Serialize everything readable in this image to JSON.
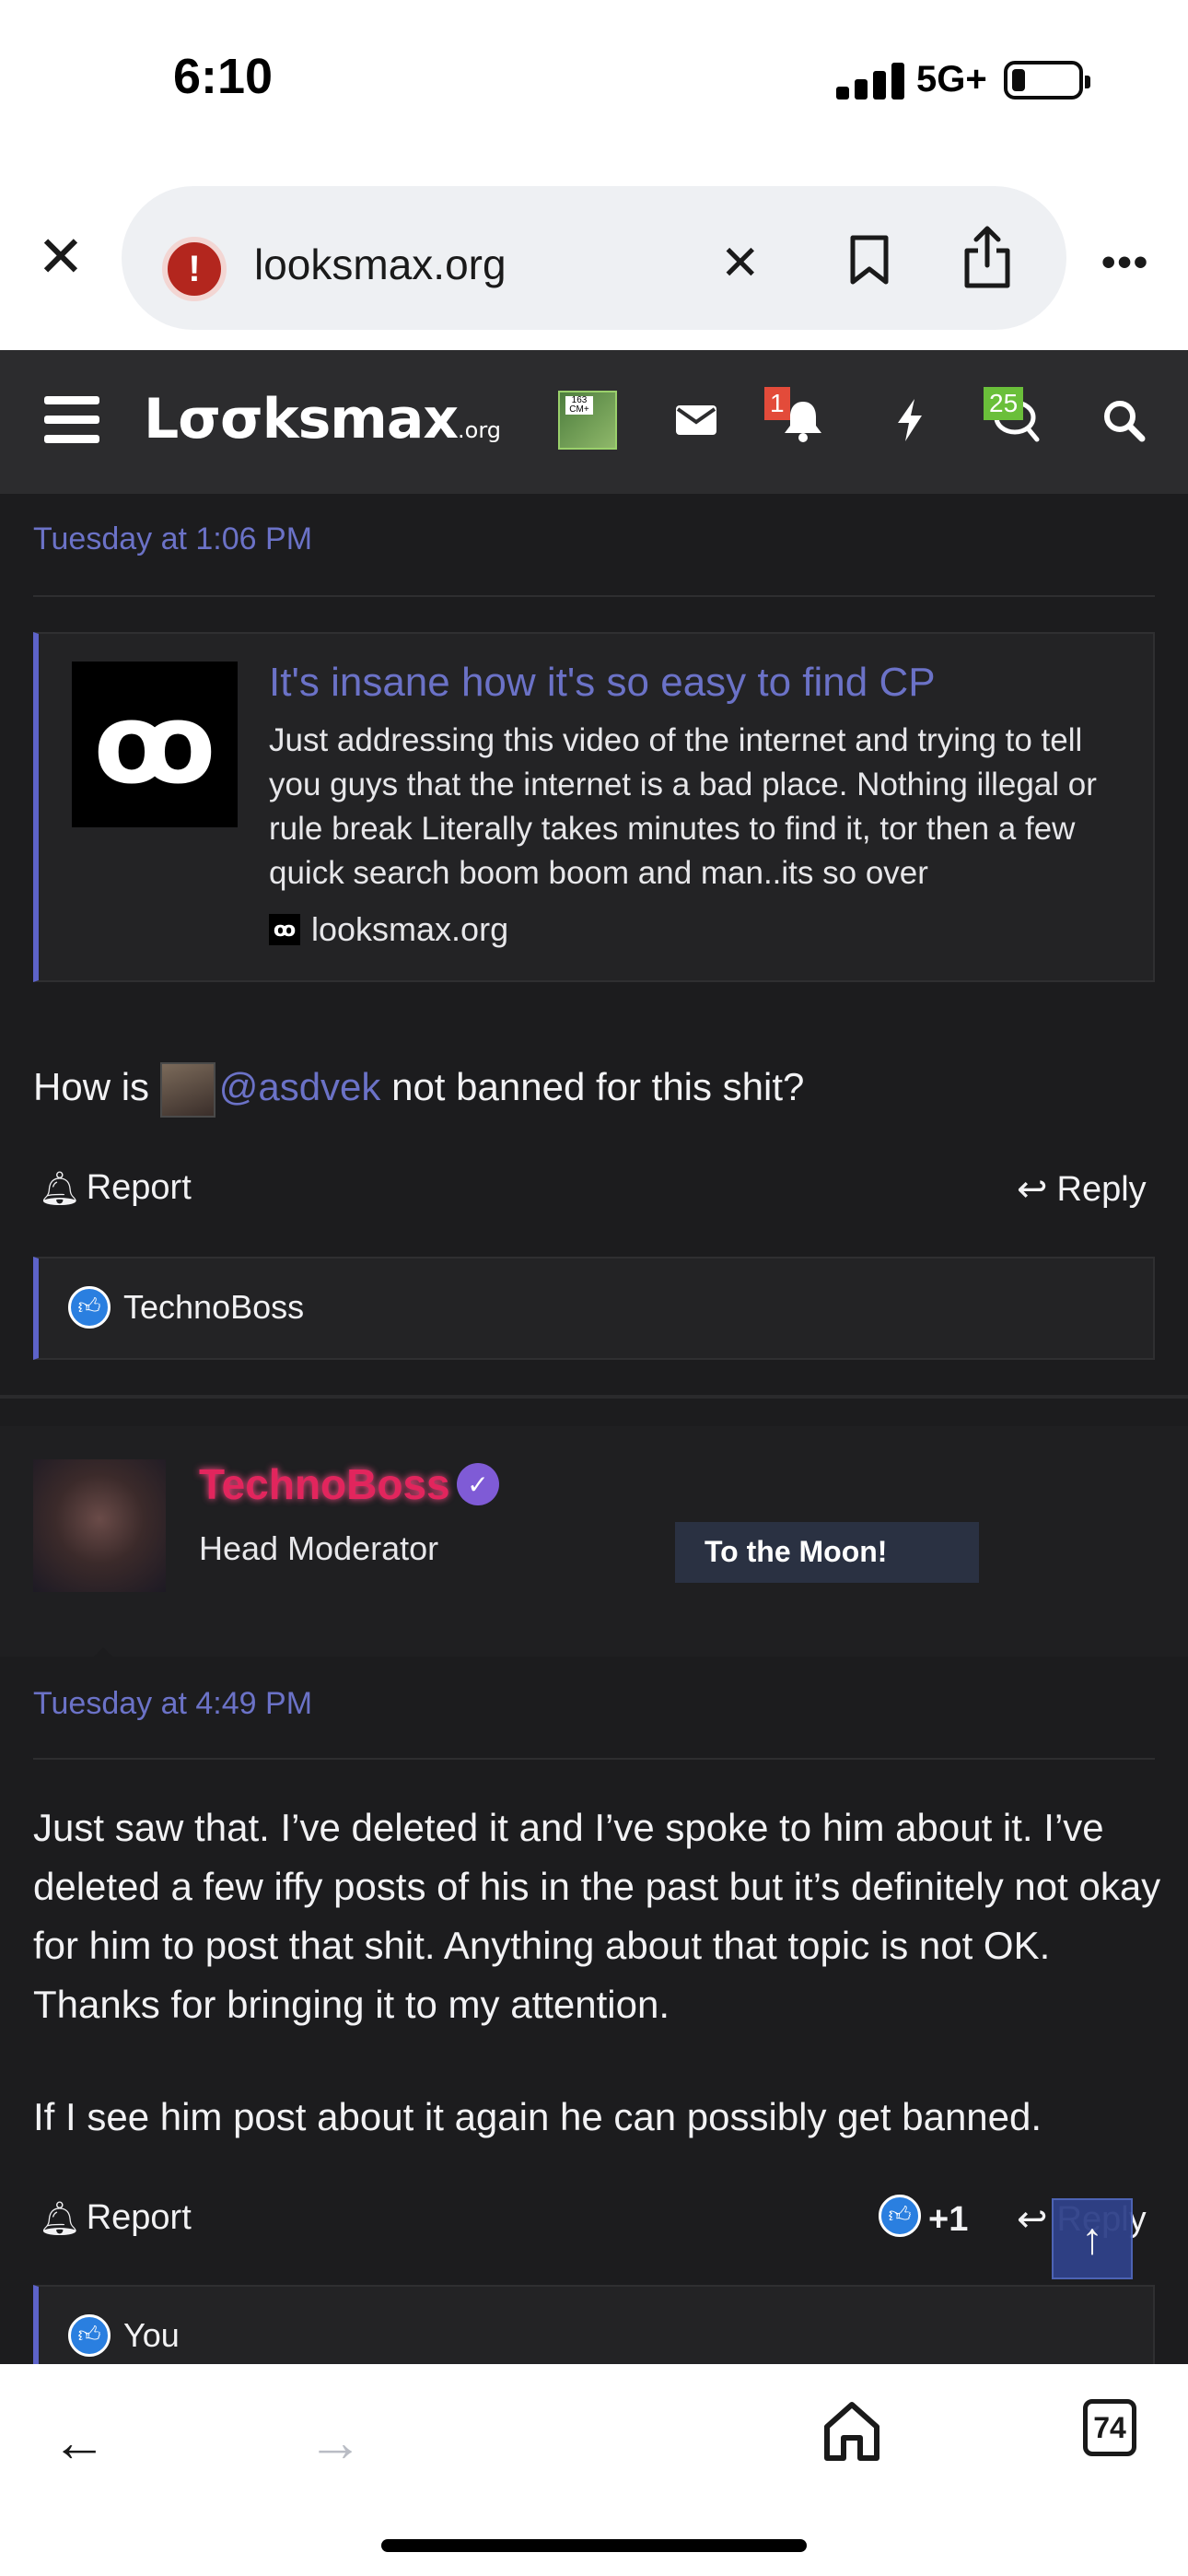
{
  "status_bar": {
    "time": "6:10",
    "network": "5G+"
  },
  "browser": {
    "url": "looksmax.org",
    "warning_glyph": "!",
    "tab_count": "74",
    "icons": [
      "close-icon",
      "site-warning-icon",
      "clear-url-icon",
      "bookmark-icon",
      "share-icon",
      "more-icon",
      "back-icon",
      "forward-icon",
      "home-icon",
      "tabs-icon"
    ]
  },
  "site_nav": {
    "logo_main": "Lσσksmax",
    "logo_suffix": ".org",
    "avatar_text": "163 CM+",
    "alerts_badge": "1",
    "conversations_badge": "25",
    "icons": [
      "hamburger-icon",
      "mail-icon",
      "bell-icon",
      "bolt-icon",
      "chat-icon",
      "search-icon"
    ],
    "badge_colors": {
      "alerts": "#e34b3a",
      "conversations": "#6abf3a"
    }
  },
  "post1": {
    "timestamp": "Tuesday at 1:06 PM",
    "embed": {
      "title": "It's insane how it's so easy to find CP",
      "text": "Just addressing this video of the internet and trying to tell you guys that the internet is a bad place. Nothing illegal or rule break Literally takes minutes to find it, tor then a few quick search boom boom and man..its so over",
      "source": "looksmax.org",
      "thumb_glyph": "ꝏ"
    },
    "body_prefix": "How is",
    "mention": "@asdvek",
    "body_suffix": "not banned for this shit?",
    "report_label": "Report",
    "reply_label": "Reply",
    "reaction_user": "TechnoBoss"
  },
  "post2": {
    "author": "TechnoBoss",
    "role": "Head Moderator",
    "banner": "To the Moon!",
    "verified_glyph": "✓",
    "timestamp": "Tuesday at 4:49 PM",
    "paragraph1": "Just saw that. I’ve deleted it and I’ve spoke to him about it. I’ve deleted a few iffy posts of his in the past but it’s definitely not okay for him to post that shit. Anything about that topic is not OK. Thanks for bringing it to my attention.",
    "paragraph2": "If I see him post about it again he can possibly get banned.",
    "report_label": "Report",
    "reaction_count": "+1",
    "reply_label": "Reply",
    "reaction_user": "You"
  },
  "colors": {
    "accent_link": "#6b72c7",
    "background": "#1c1c1e",
    "nav_background": "#2c2c2e",
    "username_color": "#e2255d",
    "like_blue": "#2a7fe0"
  }
}
